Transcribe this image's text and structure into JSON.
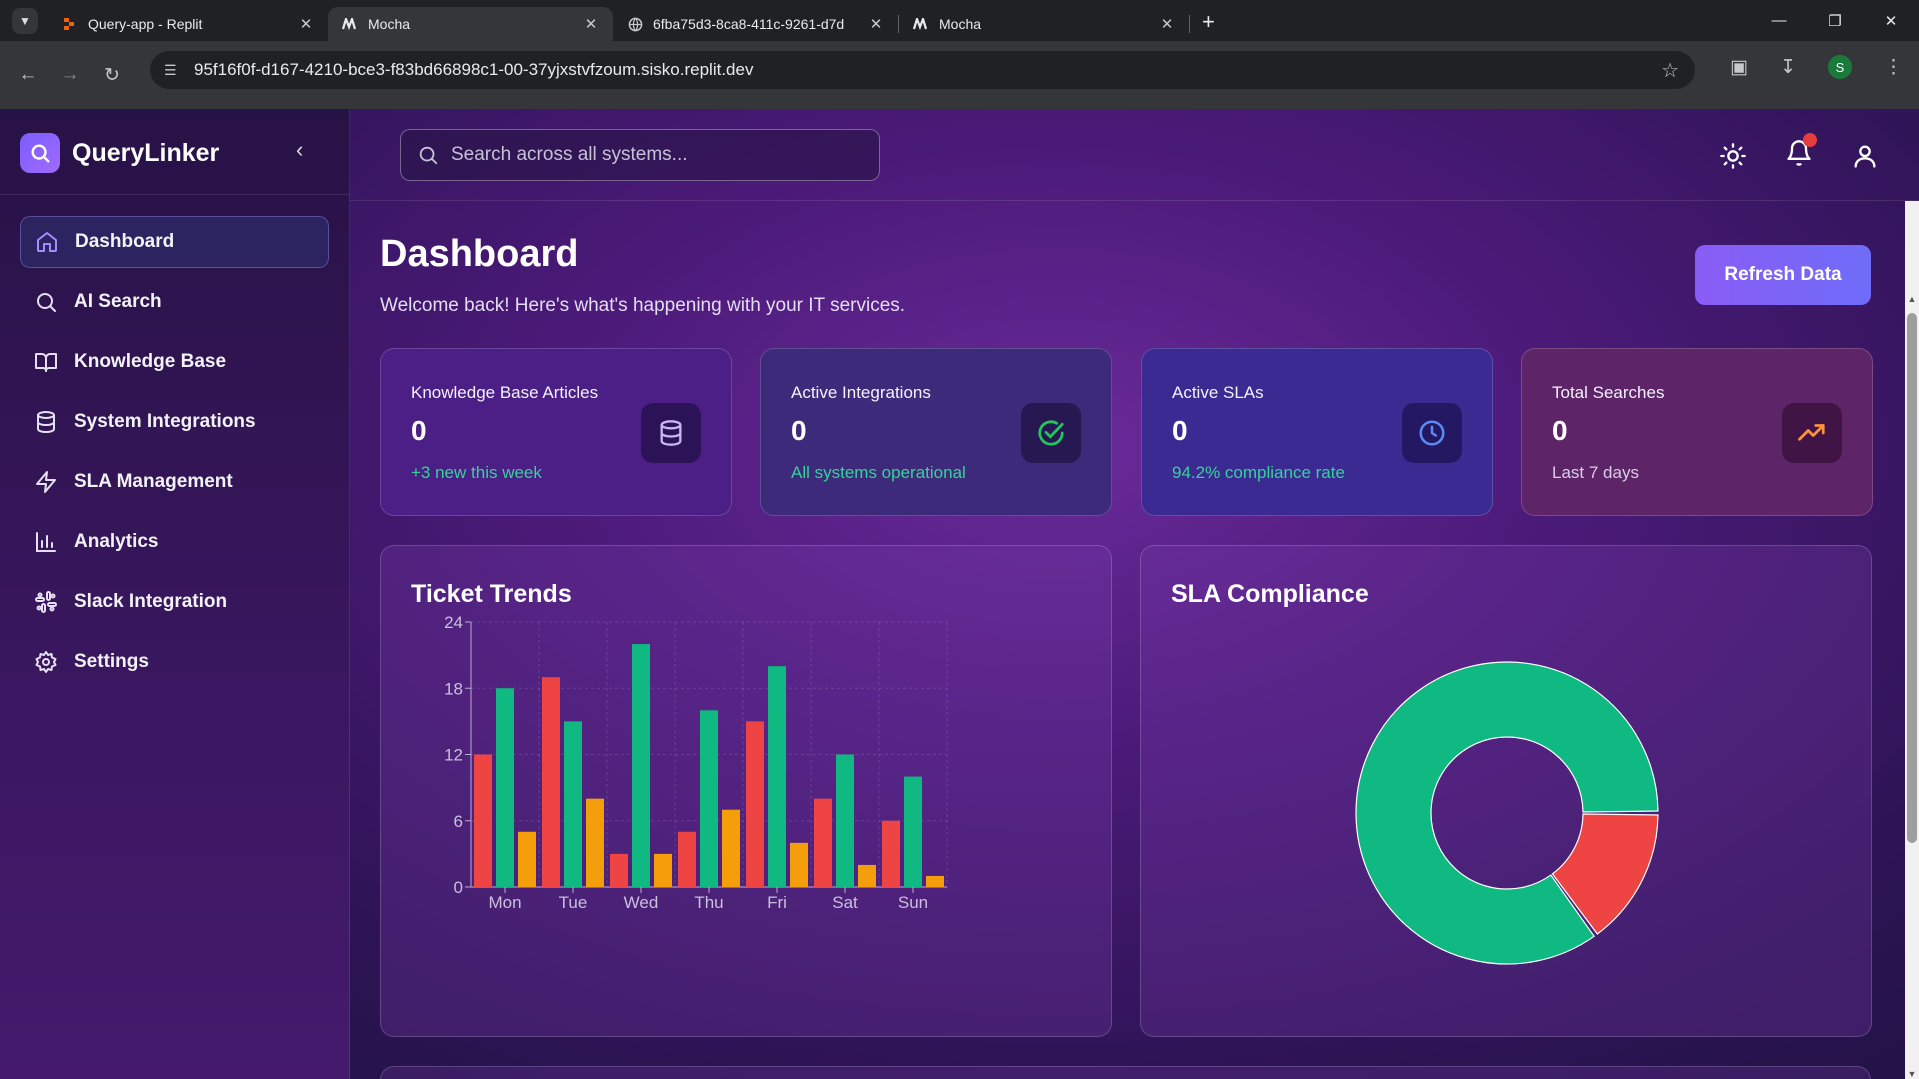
{
  "browser": {
    "tabs": [
      {
        "title": "Query-app - Replit",
        "icon": "replit-icon",
        "active": false
      },
      {
        "title": "Mocha",
        "icon": "mocha-icon",
        "active": true
      },
      {
        "title": "6fba75d3-8ca8-411c-9261-d7d",
        "icon": "globe-icon",
        "active": false
      },
      {
        "title": "Mocha",
        "icon": "mocha-icon",
        "active": false
      }
    ],
    "url": "95f16f0f-d167-4210-bce3-f83bd66898c1-00-37yjxstvfzoum.sisko.replit.dev",
    "profile_initial": "S"
  },
  "app": {
    "name": "QueryLinker",
    "search_placeholder": "Search across all systems...",
    "nav": [
      {
        "label": "Dashboard",
        "icon": "home-icon",
        "active": true
      },
      {
        "label": "AI Search",
        "icon": "search-icon",
        "active": false
      },
      {
        "label": "Knowledge Base",
        "icon": "book-icon",
        "active": false
      },
      {
        "label": "System Integrations",
        "icon": "database-icon",
        "active": false
      },
      {
        "label": "SLA Management",
        "icon": "zap-icon",
        "active": false
      },
      {
        "label": "Analytics",
        "icon": "bar-chart-icon",
        "active": false
      },
      {
        "label": "Slack Integration",
        "icon": "slack-icon",
        "active": false
      },
      {
        "label": "Settings",
        "icon": "gear-icon",
        "active": false
      }
    ]
  },
  "dashboard": {
    "title": "Dashboard",
    "subtitle": "Welcome back! Here's what's happening with your IT services.",
    "refresh_label": "Refresh Data",
    "stats": [
      {
        "label": "Knowledge Base Articles",
        "value": "0",
        "foot": "+3 new this week",
        "foot_color": "#34d399",
        "icon": "database-icon",
        "icon_color": "#c9b8f0",
        "bg": "#4b1f86"
      },
      {
        "label": "Active Integrations",
        "value": "0",
        "foot": "All systems operational",
        "foot_color": "#34d399",
        "icon": "check-circle-icon",
        "icon_color": "#22c55e",
        "bg": "#3e2a7a"
      },
      {
        "label": "Active SLAs",
        "value": "0",
        "foot": "94.2% compliance rate",
        "foot_color": "#34d399",
        "icon": "clock-icon",
        "icon_color": "#5b8cf5",
        "bg": "#3a2a92"
      },
      {
        "label": "Total Searches",
        "value": "0",
        "foot": "Last 7 days",
        "foot_color": "#d8cfe6",
        "icon": "trending-up-icon",
        "icon_color": "#fb923c",
        "bg": "#5e2468"
      }
    ],
    "ticket_trends": {
      "title": "Ticket Trends"
    },
    "sla_compliance": {
      "title": "SLA Compliance"
    }
  },
  "chart_data": [
    {
      "type": "bar",
      "title": "Ticket Trends",
      "categories": [
        "Mon",
        "Tue",
        "Wed",
        "Thu",
        "Fri",
        "Sat",
        "Sun"
      ],
      "series": [
        {
          "values": [
            12,
            19,
            3,
            5,
            15,
            8,
            6
          ],
          "color": "#ef4444"
        },
        {
          "values": [
            18,
            15,
            22,
            16,
            20,
            12,
            10
          ],
          "color": "#10b981"
        },
        {
          "values": [
            5,
            8,
            3,
            7,
            4,
            2,
            1
          ],
          "color": "#f59e0b"
        }
      ],
      "ylim": [
        0,
        24
      ],
      "yticks": [
        0,
        6,
        12,
        18,
        24
      ],
      "grid": true
    },
    {
      "type": "pie",
      "title": "SLA Compliance",
      "donut": true,
      "slices": [
        {
          "value": 85,
          "color": "#10b981"
        },
        {
          "value": 15,
          "color": "#ef4444"
        }
      ]
    }
  ]
}
